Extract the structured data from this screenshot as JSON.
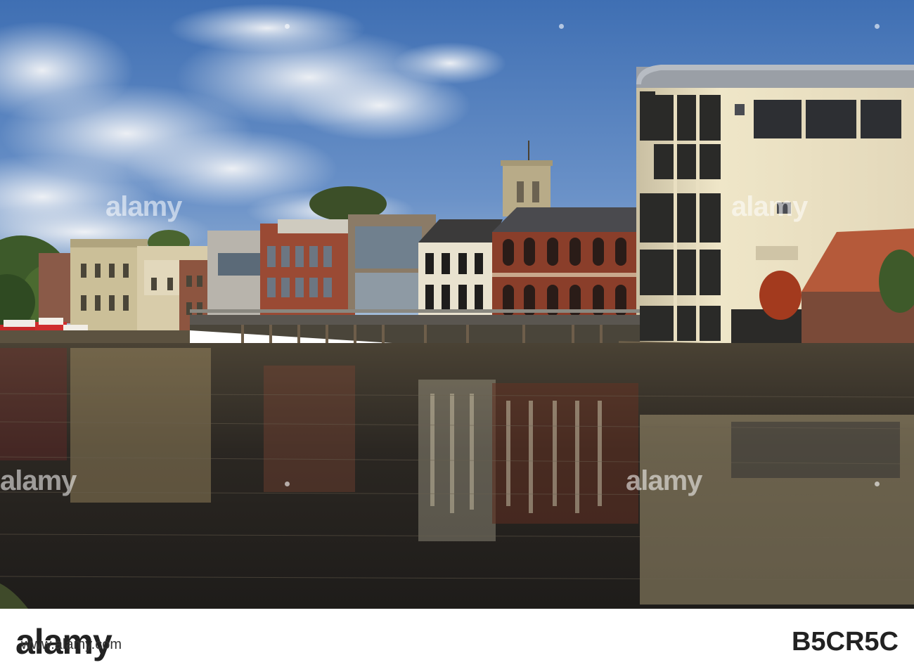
{
  "watermark": {
    "text": "alamy"
  },
  "footer": {
    "brand": "alamy",
    "image_id": "B5CR5C",
    "url": "www.alamy.com"
  },
  "colors": {
    "sky": "#4f7fbf",
    "water": "#2a2621",
    "brick": "#8a3e2a",
    "cream_building": "#e7dcc0"
  }
}
